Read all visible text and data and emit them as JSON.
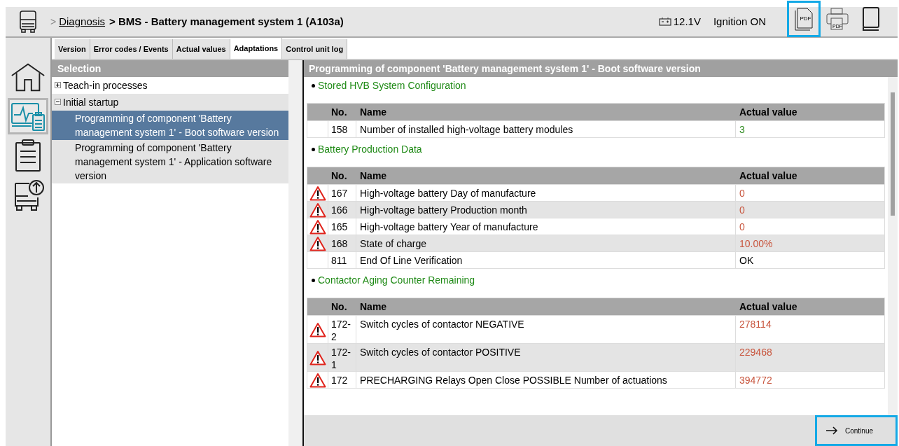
{
  "breadcrumb": {
    "prefix": ">",
    "link": "Diagnosis",
    "current": "> BMS - Battery management system 1 (A103a)"
  },
  "status": {
    "voltage": "12.1V",
    "ignition": "Ignition ON"
  },
  "toolbar": [
    {
      "kind": "pdf",
      "label": "PDF",
      "selected": true
    },
    {
      "kind": "print",
      "label": "PDF",
      "selected": false
    },
    {
      "kind": "book",
      "selected": false
    }
  ],
  "rail": [
    {
      "kind": "home",
      "selected": false
    },
    {
      "kind": "diagnosis",
      "selected": true
    },
    {
      "kind": "clipboard",
      "selected": false
    },
    {
      "kind": "update",
      "selected": false
    }
  ],
  "tabs": [
    {
      "label": "Version",
      "selected": false
    },
    {
      "label": "Error codes / Events",
      "selected": false
    },
    {
      "label": "Actual values",
      "selected": false
    },
    {
      "label": "Adaptations",
      "selected": true
    },
    {
      "label": "Control unit log",
      "selected": false
    }
  ],
  "selection": {
    "title": "Selection",
    "tree": [
      {
        "label": "Teach-in processes",
        "expanded": false,
        "selected": false
      },
      {
        "label": "Initial startup",
        "expanded": true,
        "selected": false,
        "children": [
          {
            "label": "Programming of component 'Battery management system 1' - Boot software version",
            "selected": true
          },
          {
            "label": "Programming of component 'Battery management system 1' - Application software version",
            "selected": false
          }
        ]
      }
    ]
  },
  "detail": {
    "title": "Programming of component 'Battery management system 1' - Boot software version",
    "sections": [
      {
        "title": "Stored HVB System Configuration",
        "columns": [
          "No.",
          "Name",
          "Actual value"
        ],
        "rows": [
          {
            "no": "158",
            "name": "Number of installed high-voltage battery modules",
            "value": "3",
            "kind": "good"
          }
        ]
      },
      {
        "title": "Battery Production Data",
        "columns": [
          "No.",
          "Name",
          "Actual value"
        ],
        "rows": [
          {
            "no": "167",
            "name": "High-voltage battery Day of manufacture",
            "value": "0",
            "kind": "warning"
          },
          {
            "no": "166",
            "name": "High-voltage battery Production month",
            "value": "0",
            "kind": "warning"
          },
          {
            "no": "165",
            "name": "High-voltage battery Year of manufacture",
            "value": "0",
            "kind": "warning"
          },
          {
            "no": "168",
            "name": "State of charge",
            "value": "10.00%",
            "kind": "warning"
          },
          {
            "no": "811",
            "name": "End Of Line Verification",
            "value": "OK",
            "kind": "neutral"
          }
        ]
      },
      {
        "title": "Contactor Aging Counter Remaining",
        "columns": [
          "No.",
          "Name",
          "Actual value"
        ],
        "rows": [
          {
            "no": "172-2",
            "name": "Switch cycles of contactor NEGATIVE",
            "value": "278114",
            "kind": "warning"
          },
          {
            "no": "172-1",
            "name": "Switch cycles of contactor POSITIVE",
            "value": "229468",
            "kind": "warning"
          },
          {
            "no": "172",
            "name": "PRECHARGING Relays Open Close POSSIBLE Number of actuations",
            "value": "394772",
            "kind": "warning"
          }
        ]
      }
    ]
  },
  "continue_button": {
    "label": "Continue",
    "selected": true
  }
}
